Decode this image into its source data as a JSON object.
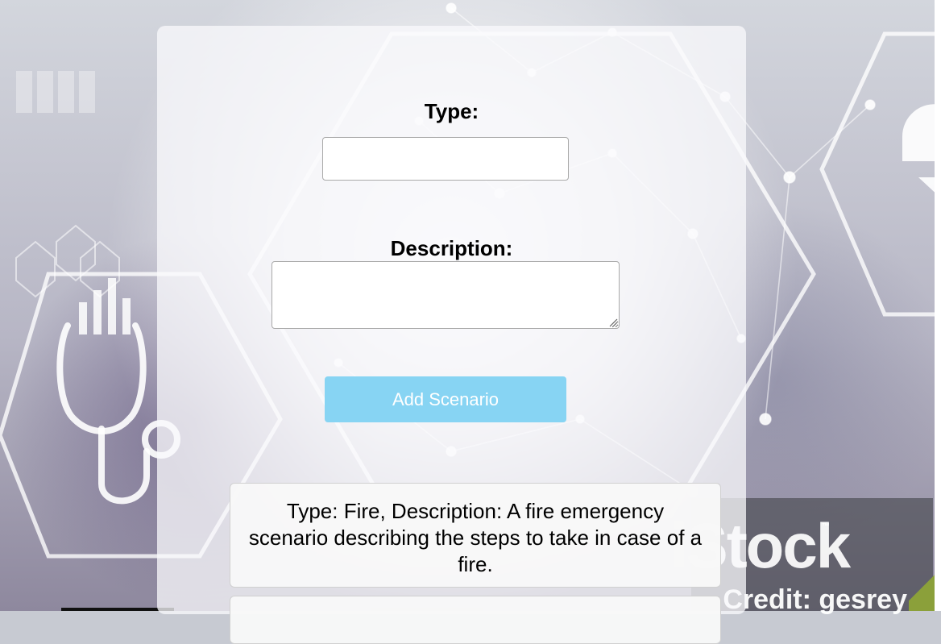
{
  "form": {
    "type_label": "Type:",
    "type_value": "",
    "description_label": "Description:",
    "description_value": "",
    "submit_label": "Add Scenario"
  },
  "scenarios": [
    {
      "text": "Type: Fire, Description: A fire emergency scenario describing the steps to take in case of a fire."
    },
    {
      "text": ""
    }
  ],
  "watermark": {
    "brand": "iStock",
    "trademark": "™",
    "credit": "Credit: gesrey"
  },
  "colors": {
    "button": "#87d4f3",
    "card": "#fafafc",
    "accent_green": "#8ba03a"
  },
  "icons": [
    "stethoscope-icon",
    "hexagon-frame-icon",
    "network-graph-icon"
  ]
}
